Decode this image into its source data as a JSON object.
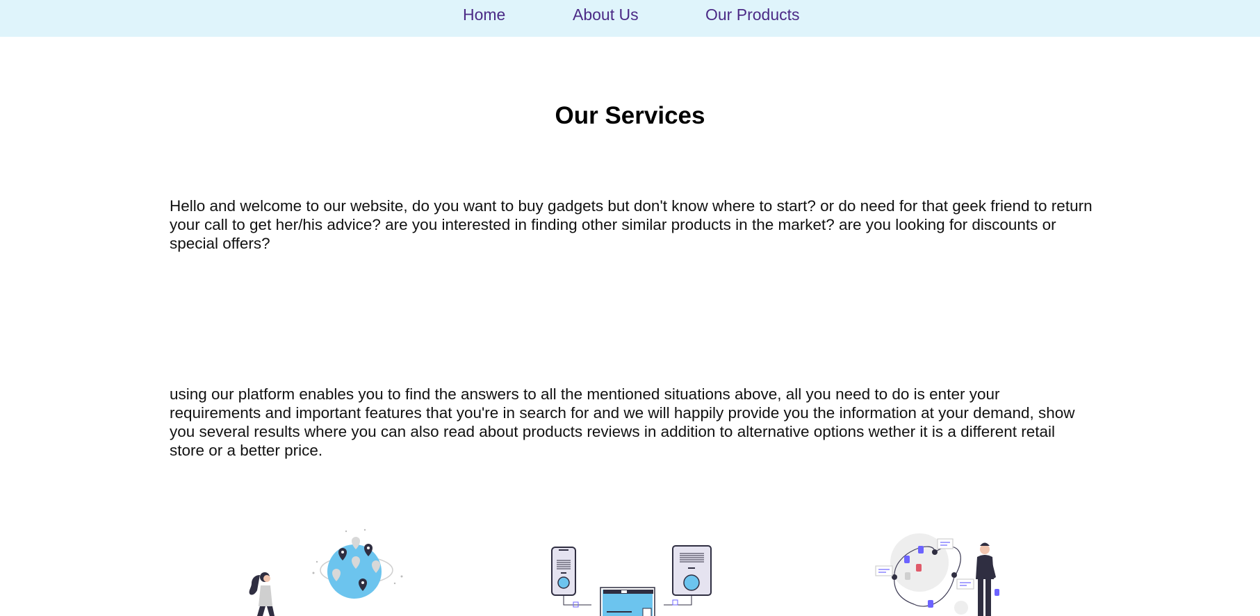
{
  "nav": {
    "home": "Home",
    "about": "About Us",
    "products": "Our Products"
  },
  "main": {
    "title": "Our Services",
    "paragraph_1": "Hello and welcome to our website, do you want to buy gadgets but don't know where to start? or do need for that geek friend to return your call to get her/his advice? are you interested in finding other similar products in the market? are you looking for discounts or special offers?",
    "paragraph_2": "using our platform enables you to find the answers to all the mentioned situations above, all you need to do is enter your requirements and important features that you're in search for and we will happily provide you the information at your demand, show you several results where you can also read about products reviews in addition to alternative options wether it is a different retail store or a better price."
  },
  "illustrations": [
    {
      "icon": "person-with-globe-map-pins-icon"
    },
    {
      "icon": "connected-devices-icon"
    },
    {
      "icon": "person-with-product-network-icon"
    }
  ],
  "colors": {
    "nav_background": "#dff4fb",
    "nav_link": "#4b2a86",
    "accent_blue": "#6cc4ee",
    "accent_purple": "#6c63ff",
    "accent_red": "#e05a6a",
    "dark": "#2f2e41"
  }
}
